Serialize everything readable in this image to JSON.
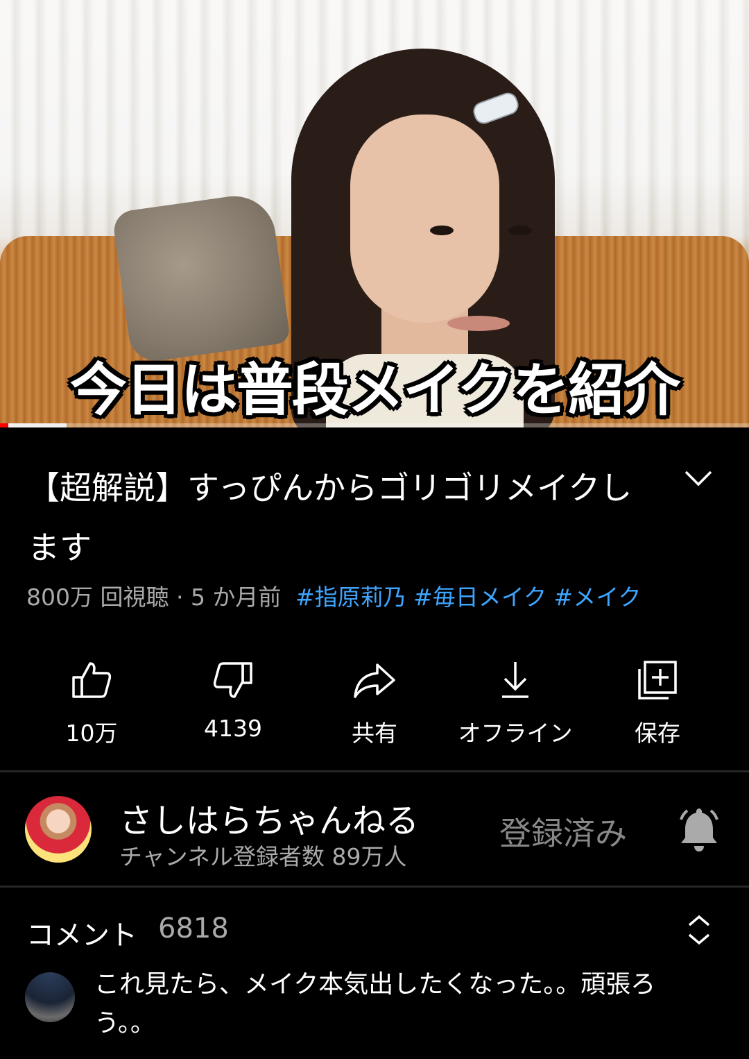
{
  "video": {
    "caption": "今日は普段メイクを紹介",
    "progress_percent": 1.1
  },
  "info": {
    "title": "【超解説】すっぴんからゴリゴリメイクします",
    "views": "800万 回視聴 · 5 か月前",
    "hashtags": "#指原莉乃 #毎日メイク #メイク"
  },
  "actions": {
    "like": "10万",
    "dislike": "4139",
    "share": "共有",
    "offline": "オフライン",
    "save": "保存"
  },
  "channel": {
    "name": "さしはらちゃんねる",
    "subscribers": "チャンネル登録者数 89万人",
    "subscribe_state": "登録済み"
  },
  "comments": {
    "label": "コメント",
    "count": "6818",
    "top_comment": "これ見たら、メイク本気出したくなった。。頑張ろう。。"
  },
  "icons": {
    "expand": "chevron-down-icon",
    "like": "thumbs-up-icon",
    "dislike": "thumbs-down-icon",
    "share": "share-icon",
    "offline": "download-icon",
    "save": "save-to-playlist-icon",
    "bell": "bell-icon",
    "sort": "sort-icon"
  },
  "colors": {
    "background": "#000000",
    "hashtag": "#3ea6ff",
    "progress": "#ff0000",
    "secondary_text": "#aaaaaa"
  }
}
